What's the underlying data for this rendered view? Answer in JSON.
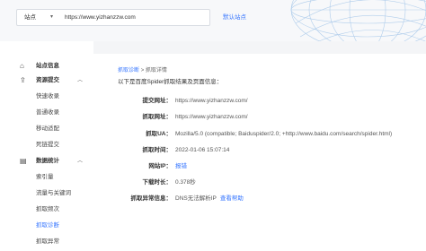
{
  "header": {
    "site_label": "站点",
    "site_url": "https://www.yizhanzzw.com",
    "add_site": "默认站点"
  },
  "sidebar": {
    "items": [
      {
        "label": "站点信息",
        "icon": "home-icon",
        "type": "group"
      },
      {
        "label": "资源提交",
        "icon": "upload-icon",
        "type": "group",
        "arrow": "︿"
      },
      {
        "label": "快速收录",
        "type": "sub"
      },
      {
        "label": "普通收录",
        "type": "sub"
      },
      {
        "label": "移动适配",
        "type": "sub"
      },
      {
        "label": "死链提交",
        "type": "sub"
      },
      {
        "label": "数据统计",
        "icon": "chart-icon",
        "type": "group",
        "arrow": "︿"
      },
      {
        "label": "索引量",
        "type": "sub"
      },
      {
        "label": "流量与关键词",
        "type": "sub"
      },
      {
        "label": "抓取频次",
        "type": "sub"
      },
      {
        "label": "抓取诊断",
        "type": "sub",
        "active": true
      },
      {
        "label": "抓取异常",
        "type": "sub"
      }
    ]
  },
  "main": {
    "breadcrumb": {
      "parent": "抓取诊断",
      "sep": ">",
      "current": "抓取详情"
    },
    "intro": "以下是百度Spider抓取结果及页面信息：",
    "rows": [
      {
        "label": "提交网址：",
        "value": "https://www.yizhanzzw.com/"
      },
      {
        "label": "抓取网址：",
        "value": "https://www.yizhanzzw.com/"
      },
      {
        "label": "抓取UA：",
        "value": "Mozilla/5.0 (compatible; Baiduspider/2.0; +http://www.baidu.com/search/spider.html)"
      },
      {
        "label": "抓取时间：",
        "value": "2022-01-06 15:07:14"
      },
      {
        "label": "网站IP：",
        "value": "报错"
      },
      {
        "label": "下载时长：",
        "value": "0.378秒"
      },
      {
        "label": "抓取异常信息：",
        "value": "DNS无法解析IP",
        "help": "查看帮助"
      }
    ]
  },
  "colors": {
    "accent": "#3575ff",
    "page_bg": "#f4f5f7"
  }
}
